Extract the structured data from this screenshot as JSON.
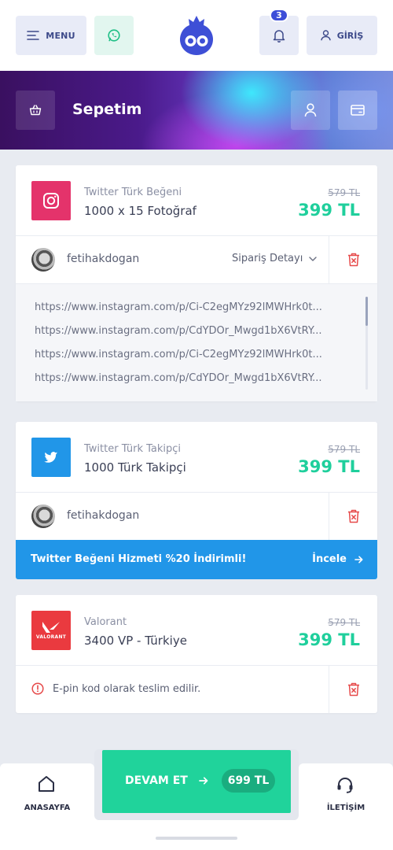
{
  "header": {
    "menu_label": "MENU",
    "notification_count": "3",
    "login_label": "GİRİŞ"
  },
  "banner": {
    "title": "Sepetim"
  },
  "cart": [
    {
      "category": "Twitter Türk Beğeni",
      "name": "1000 x 15 Fotoğraf",
      "old_price": "579 TL",
      "price": "399 TL",
      "icon": "instagram-icon",
      "icon_color": "#e4336b",
      "username": "fetihakdogan",
      "order_detail_label": "Sipariş Detayı",
      "urls": [
        "https://www.instagram.com/p/Ci-C2egMYz92lMWHrk0t...",
        "https://www.instagram.com/p/CdYDOr_Mwgd1bX6VtRY...",
        "https://www.instagram.com/p/Ci-C2egMYz92lMWHrk0t...",
        "https://www.instagram.com/p/CdYDOr_Mwgd1bX6VtRY..."
      ]
    },
    {
      "category": "Twitter Türk Takipçi",
      "name": "1000 Türk Takipçi",
      "old_price": "579 TL",
      "price": "399 TL",
      "icon": "twitter-icon",
      "icon_color": "#2196e8",
      "username": "fetihakdogan",
      "promo_text": "Twitter Beğeni Hizmeti %20 İndirimli!",
      "promo_link": "İncele"
    },
    {
      "category": "Valorant",
      "name": "3400 VP - Türkiye",
      "old_price": "579 TL",
      "price": "399 TL",
      "icon": "valorant-logo",
      "icon_color": "#ea3a3f",
      "logo_text": "VALORANT",
      "notice": "E-pin kod olarak teslim edilir."
    }
  ],
  "bottom_nav": {
    "home_label": "ANASAYFA",
    "continue_label": "DEVAM ET",
    "total": "699 TL",
    "contact_label": "İLETİŞİM"
  },
  "colors": {
    "accent": "#20d39b",
    "price": "#1fcf9c",
    "danger": "#e64a4a",
    "primary": "#3d4ed8"
  }
}
